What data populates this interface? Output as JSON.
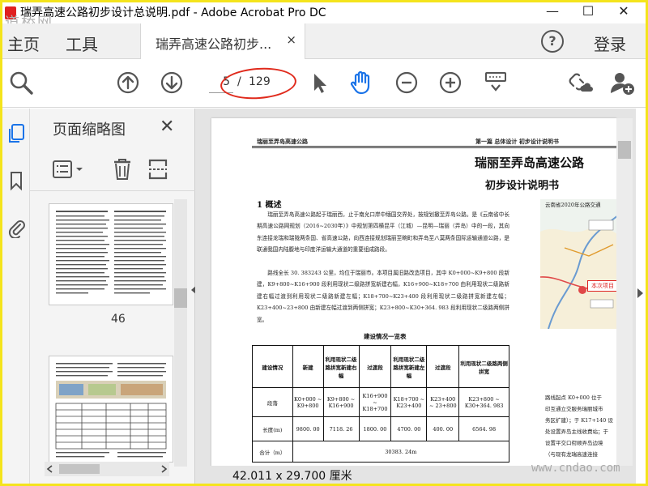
{
  "window": {
    "title": "瑞弄高速公路初步设计总说明.pdf - Adobe Acrobat Pro DC",
    "minimize": "—",
    "maximize": "☐",
    "close": "✕",
    "watermark_top_left": "道桥网"
  },
  "tabs": {
    "home": "主页",
    "tools": "工具",
    "document": "瑞弄高速公路初步...",
    "document_close": "×",
    "help": "?",
    "login": "登录"
  },
  "toolbar": {
    "current_page": "5",
    "separator": "/",
    "total_pages": "129"
  },
  "thumbnail_panel": {
    "title": "页面缩略图",
    "close": "✕",
    "page_label": "46"
  },
  "document": {
    "running_header_left": "瑞丽至弄岛高速公路",
    "running_header_right": "第一篇  总体设计  初步设计说明书",
    "title": "瑞丽至弄岛高速公路",
    "subtitle": "初步设计说明书",
    "section_heading": "1  概述",
    "paragraph_1": "瑞丽至弄岛高速公路起于瑞丽西，止于南允口岸中缅国交界处，按规划撤至弄岛公路。是《云南省中长期高速公路网规划（2016~2030年）》中规划第四横昆平（江城）—昆明—瑞丽（弄岛）中的一段，其向东连接龙瑞和瑞陇两条国、省高速公路，向西连接规划瑞丽至畹町和弄岛至八莫两条国际运输通道公路，是联通我国内陆腹地与印度洋运输大通道的重要组成路段。",
    "paragraph_2": "路线全长 30. 383243 公里，均位于瑞丽市。本项目属旧路改造项目，其中 K0+000~K9+800 段新建，K9+800~K16+900 段利用现状二级路拼宽新建右幅，K16+900~K18+700 由利用现状二级路新建右幅过渡到利用现状二级路新建左幅；K18+700~K23+400 段利用现状二级路拼宽新建左幅；K23+400~23+800 由新建左幅过渡到两侧拼宽；K23+800~K30+364. 983 段利用现状二级路两侧拼宽。",
    "table_title": "建设情况一览表",
    "table": {
      "headers": [
        "建设情况",
        "新建",
        "利用现状二级路拼宽新建右幅",
        "过渡段",
        "利用现状二级路拼宽新建左幅",
        "过渡段",
        "利用现状二级路两侧拼宽"
      ],
      "rows": [
        [
          "段落",
          "K0+000 ~ K9+800",
          "K9+800 ~ K16+900",
          "K16+900 ~ K18+700",
          "K18+700 ~ K23+400",
          "K23+400 ~ 23+800",
          "K23+800 ~ K30+364. 983"
        ],
        [
          "长度(m)",
          "9800. 00",
          "7118. 26",
          "1800. 00",
          "4700. 00",
          "400. 00",
          "6564. 98"
        ],
        [
          "合计（m）",
          "30383. 24m"
        ]
      ]
    },
    "map_title": "云南省2020年公路交通",
    "map_tag": "本次项目",
    "side_text": [
      "路线起点 K0+000 位于",
      "印互通立交服务瑞丽城市",
      "务区扩建）；于 K17+140 设",
      "处设置弄岛主线收费站；于",
      "设置平交口衔顺弄岛边境",
      "（与现有龙瑞高速连接"
    ]
  },
  "status_bar": {
    "page_size": "42.011 x 29.700 厘米"
  },
  "watermark_bottom_right": "www.cndao.com",
  "colors": {
    "frame": "#f4e41c",
    "annotation_oval": "#e02a1c",
    "hand_tool_active": "#1a73e8"
  }
}
